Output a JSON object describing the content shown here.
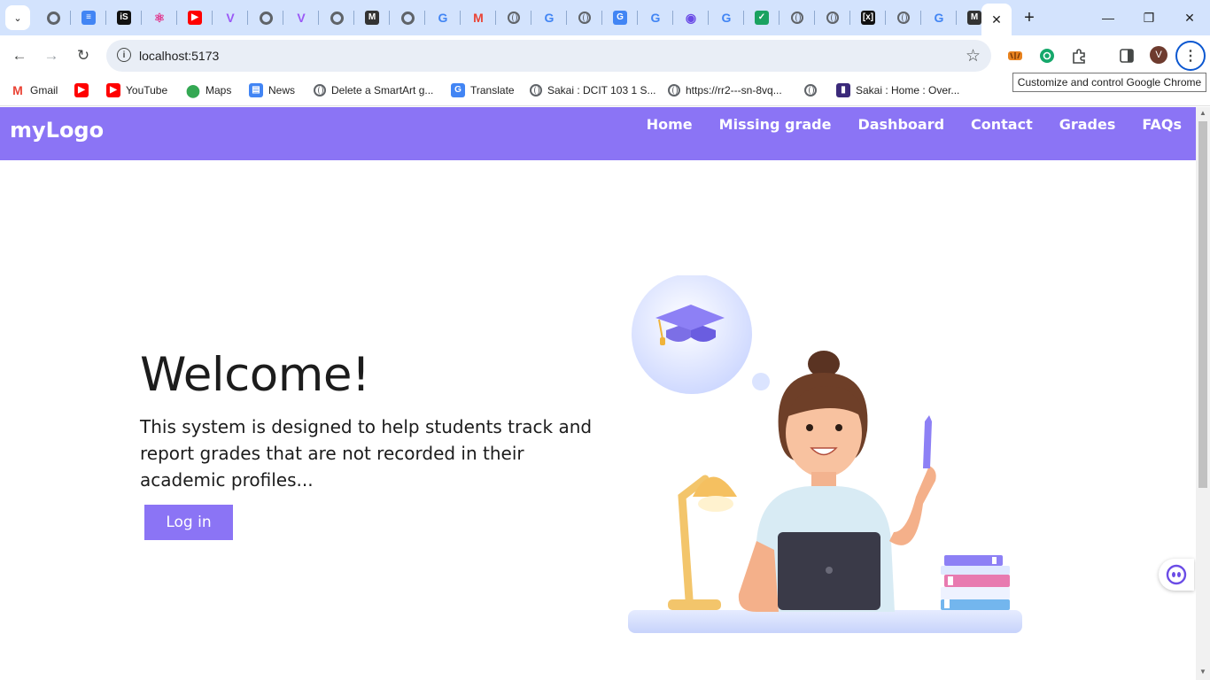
{
  "browser": {
    "tooltip": "Customize and control Google Chrome",
    "url": "localhost:5173",
    "avatar_initial": "V",
    "pinned_tabs": [
      {
        "icon": "chrome-icon",
        "color": "#5f6368"
      },
      {
        "icon": "docs-icon",
        "color": "#4285f4"
      },
      {
        "icon": "is-icon",
        "color": "#111111"
      },
      {
        "icon": "react-icon",
        "color": "#e0368c"
      },
      {
        "icon": "youtube-icon",
        "color": "#ff0000"
      },
      {
        "icon": "vite-icon",
        "color": "#9b59f6"
      },
      {
        "icon": "chrome-icon",
        "color": "#5f6368"
      },
      {
        "icon": "vite-icon",
        "color": "#9b59f6"
      },
      {
        "icon": "chrome-icon",
        "color": "#5f6368"
      },
      {
        "icon": "medium-icon",
        "color": "#333333"
      },
      {
        "icon": "chrome-icon",
        "color": "#5f6368"
      },
      {
        "icon": "google-icon",
        "color": "#4285f4"
      },
      {
        "icon": "gmail-icon",
        "color": "#ea4335"
      },
      {
        "icon": "globe-icon",
        "color": "#5f6368"
      },
      {
        "icon": "google-icon",
        "color": "#4285f4"
      },
      {
        "icon": "globe-icon",
        "color": "#9aa0a6"
      },
      {
        "icon": "translate-icon",
        "color": "#4285f4"
      },
      {
        "icon": "google-icon",
        "color": "#4285f4"
      },
      {
        "icon": "bot-icon",
        "color": "#6b4ce6"
      },
      {
        "icon": "google-icon",
        "color": "#4285f4"
      },
      {
        "icon": "check-icon",
        "color": "#1aa260"
      },
      {
        "icon": "globe-icon",
        "color": "#5f6368"
      },
      {
        "icon": "globe-icon",
        "color": "#5f6368"
      },
      {
        "icon": "bracket-icon",
        "color": "#111111"
      },
      {
        "icon": "globe-icon",
        "color": "#5f6368"
      },
      {
        "icon": "google-icon",
        "color": "#4285f4"
      },
      {
        "icon": "medium-icon",
        "color": "#333333"
      }
    ],
    "bookmarks": [
      {
        "label": "Gmail",
        "icon": "gmail-icon"
      },
      {
        "label": "",
        "icon": "youtube-icon"
      },
      {
        "label": "YouTube",
        "icon": "youtube-icon"
      },
      {
        "label": "Maps",
        "icon": "maps-icon"
      },
      {
        "label": "News",
        "icon": "news-icon"
      },
      {
        "label": "Delete a SmartArt g...",
        "icon": "globe-icon"
      },
      {
        "label": "Translate",
        "icon": "translate-icon"
      },
      {
        "label": "Sakai : DCIT 103 1 S...",
        "icon": "globe-icon"
      },
      {
        "label": "https://rr2---sn-8vq...",
        "icon": "globe-icon"
      },
      {
        "label": "",
        "icon": "globe-icon"
      },
      {
        "label": "Sakai : Home : Over...",
        "icon": "sakai-icon"
      }
    ]
  },
  "site": {
    "logo": "myLogo",
    "nav": [
      "Home",
      "Missing grade",
      "Dashboard",
      "Contact",
      "Grades",
      "FAQs"
    ],
    "hero": {
      "title": "Welcome!",
      "text": "This system is designed to help students track and report grades that are not recorded in their academic profiles...",
      "button": "Log in"
    },
    "brand_color": "#8b74f5"
  }
}
